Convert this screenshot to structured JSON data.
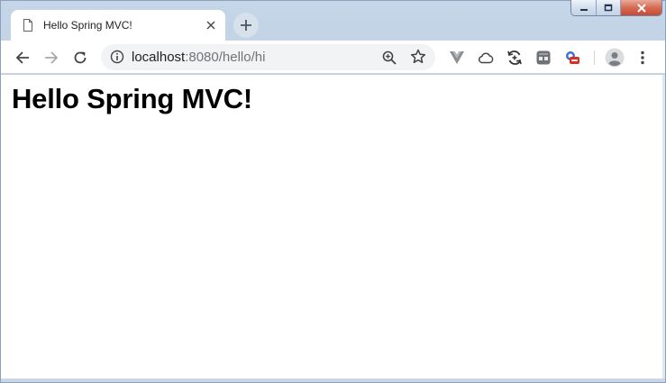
{
  "window": {
    "controls": {
      "minimize_icon": "minimize-icon",
      "maximize_icon": "maximize-icon",
      "close_icon": "close-icon"
    }
  },
  "tab": {
    "title": "Hello Spring MVC!",
    "icon": "document-icon",
    "close_glyph": "✕"
  },
  "new_tab": {
    "glyph": "+"
  },
  "toolbar": {
    "url_host": "localhost",
    "url_path": ":8080/hello/hi",
    "extensions": [
      "vue-devtools-icon",
      "cloud-icon",
      "sync-icon",
      "dark-reader-icon",
      "adblock-icon"
    ]
  },
  "page": {
    "heading": "Hello Spring MVC!"
  },
  "colors": {
    "frame": "#b9cce2",
    "close": "#c74a33",
    "omnibox": "#f1f3f4"
  }
}
